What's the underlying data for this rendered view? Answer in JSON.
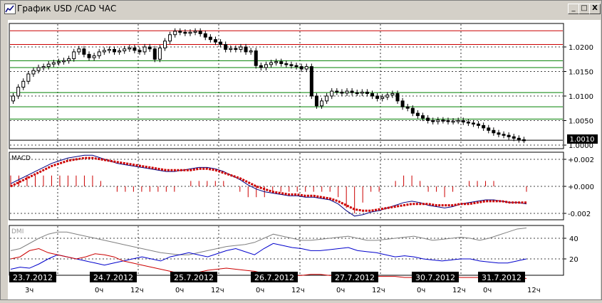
{
  "window": {
    "title": "График USD /CAD  ЧАС",
    "buttons": {
      "minimize": "_",
      "maximize": "□",
      "close": "X"
    }
  },
  "colors": {
    "candle": "#000000",
    "resistance": "#cc0000",
    "support": "#008000",
    "macd_line": "#000080",
    "macd_signal": "#cc0000",
    "dmi_adx": "#808080",
    "dmi_plus": "#0000cc",
    "dmi_minus": "#cc0000"
  },
  "price_panel": {
    "current_price": "1.0010",
    "y_ticks": [
      "1.0200",
      "1.0150",
      "1.0100",
      "1.0050",
      "1.0000"
    ],
    "resistance_levels": [
      1.0233,
      1.0205
    ],
    "support_levels": [
      1.0172,
      1.0158,
      1.0107,
      1.0078,
      1.0053
    ]
  },
  "macd_panel": {
    "label": "MACD",
    "y_ticks": [
      "+0.002",
      "+0.000",
      "-0.002"
    ]
  },
  "dmi_panel": {
    "label": "DMI",
    "y_ticks": [
      "40",
      "20"
    ]
  },
  "x_axis": {
    "dates": [
      "23.7.2012",
      "24.7.2012",
      "25.7.2012",
      "26.7.2012",
      "27.7.2012",
      "30.7.2012",
      "31.7.2012"
    ],
    "hours": [
      "3ч",
      "0ч",
      "12ч",
      "0ч",
      "12ч",
      "0ч",
      "12ч",
      "0ч",
      "12ч",
      "0ч",
      "12ч",
      "0ч",
      "12ч",
      "0ч",
      "12ч"
    ]
  },
  "chart_data": {
    "type": "candlestick",
    "instrument": "USD/CAD",
    "timeframe": "ЧАС",
    "close_series": [
      1.01,
      1.0118,
      1.013,
      1.0145,
      1.0152,
      1.0158,
      1.016,
      1.0165,
      1.0168,
      1.017,
      1.0172,
      1.0176,
      1.019,
      1.0196,
      1.0185,
      1.0178,
      1.0182,
      1.019,
      1.0193,
      1.0195,
      1.019,
      1.0192,
      1.0196,
      1.0198,
      1.0193,
      1.019,
      1.02,
      1.0196,
      1.0175,
      1.0198,
      1.0212,
      1.0225,
      1.0232,
      1.023,
      1.0228,
      1.023,
      1.0232,
      1.0227,
      1.022,
      1.0215,
      1.021,
      1.0205,
      1.0195,
      1.0197,
      1.0195,
      1.02,
      1.019,
      1.0192,
      1.0162,
      1.0158,
      1.0164,
      1.0168,
      1.017,
      1.0166,
      1.0164,
      1.0162,
      1.016,
      1.0155,
      1.016,
      1.01,
      1.008,
      1.009,
      1.01,
      1.011,
      1.0108,
      1.0106,
      1.011,
      1.0107,
      1.0106,
      1.0108,
      1.0105,
      1.01,
      1.0095,
      1.0098,
      1.0102,
      1.0105,
      1.009,
      1.0078,
      1.0075,
      1.0065,
      1.006,
      1.0055,
      1.005,
      1.0048,
      1.0051,
      1.005,
      1.0048,
      1.0049,
      1.005,
      1.0047,
      1.0045,
      1.0043,
      1.004,
      1.0035,
      1.003,
      1.0025,
      1.0022,
      1.002,
      1.0017,
      1.0014,
      1.0011,
      1.001
    ],
    "macd": [
      0.0002,
      0.0005,
      0.0008,
      0.0011,
      0.0014,
      0.0017,
      0.0019,
      0.0021,
      0.0022,
      0.0023,
      0.0023,
      0.0021,
      0.0019,
      0.0017,
      0.0016,
      0.0015,
      0.0014,
      0.0013,
      0.0012,
      0.0011,
      0.0011,
      0.0012,
      0.0013,
      0.0014,
      0.0014,
      0.0013,
      0.0011,
      0.0008,
      0.0005,
      0.0001,
      -0.0002,
      -0.0004,
      -0.0005,
      -0.0006,
      -0.0007,
      -0.0007,
      -0.0008,
      -0.0008,
      -0.0009,
      -0.001,
      -0.0013,
      -0.0018,
      -0.0022,
      -0.0021,
      -0.0019,
      -0.0018,
      -0.0016,
      -0.0014,
      -0.0012,
      -0.0011,
      -0.0012,
      -0.0014,
      -0.0015,
      -0.0016,
      -0.0015,
      -0.0013,
      -0.0012,
      -0.0011,
      -0.001,
      -0.001,
      -0.0011,
      -0.0012,
      -0.0012,
      -0.0013
    ],
    "macd_signal": [
      0.0,
      0.0003,
      0.0006,
      0.0009,
      0.0012,
      0.0015,
      0.0017,
      0.0019,
      0.002,
      0.0021,
      0.0021,
      0.002,
      0.0019,
      0.0018,
      0.0017,
      0.0016,
      0.0015,
      0.0014,
      0.0013,
      0.0012,
      0.0012,
      0.0012,
      0.0012,
      0.0013,
      0.0013,
      0.0012,
      0.001,
      0.0008,
      0.0006,
      0.0003,
      0.0,
      -0.0002,
      -0.0004,
      -0.0005,
      -0.0006,
      -0.0006,
      -0.0007,
      -0.0007,
      -0.0008,
      -0.0009,
      -0.0011,
      -0.0014,
      -0.0017,
      -0.0018,
      -0.0018,
      -0.0017,
      -0.0016,
      -0.0015,
      -0.0014,
      -0.0013,
      -0.0013,
      -0.0013,
      -0.0014,
      -0.0014,
      -0.0014,
      -0.0013,
      -0.0013,
      -0.0012,
      -0.0011,
      -0.0011,
      -0.0011,
      -0.0012,
      -0.0012,
      -0.0012
    ],
    "dmi_adx": [
      28,
      30,
      35,
      40,
      44,
      46,
      46,
      44,
      42,
      40,
      38,
      36,
      34,
      32,
      30,
      28,
      26,
      25,
      24,
      24,
      26,
      28,
      30,
      32,
      33,
      34,
      36,
      40,
      44,
      42,
      40,
      38,
      38,
      39,
      40,
      41,
      42,
      40,
      38,
      38,
      39,
      40,
      41,
      42,
      40,
      38,
      39,
      40,
      41,
      40,
      38,
      40,
      43,
      46,
      49,
      50
    ],
    "dmi_plus": [
      10,
      12,
      11,
      15,
      20,
      24,
      22,
      20,
      18,
      16,
      14,
      16,
      18,
      20,
      22,
      20,
      18,
      22,
      24,
      26,
      24,
      22,
      25,
      28,
      30,
      27,
      24,
      30,
      35,
      33,
      31,
      30,
      28,
      28,
      29,
      30,
      31,
      28,
      27,
      26,
      24,
      22,
      23,
      22,
      20,
      19,
      18,
      19,
      20,
      20,
      18,
      17,
      16,
      16,
      18,
      20
    ],
    "dmi_minus": [
      20,
      22,
      28,
      30,
      26,
      24,
      22,
      20,
      22,
      25,
      24,
      22,
      18,
      16,
      14,
      12,
      10,
      8,
      6,
      6,
      7,
      9,
      10,
      11,
      10,
      9,
      8,
      6,
      5,
      4,
      4,
      4,
      5,
      5,
      4,
      4,
      4,
      4,
      3,
      3,
      3,
      3,
      2,
      2,
      2,
      3,
      3,
      3,
      2,
      2,
      2,
      2,
      2,
      2,
      2,
      1
    ]
  }
}
